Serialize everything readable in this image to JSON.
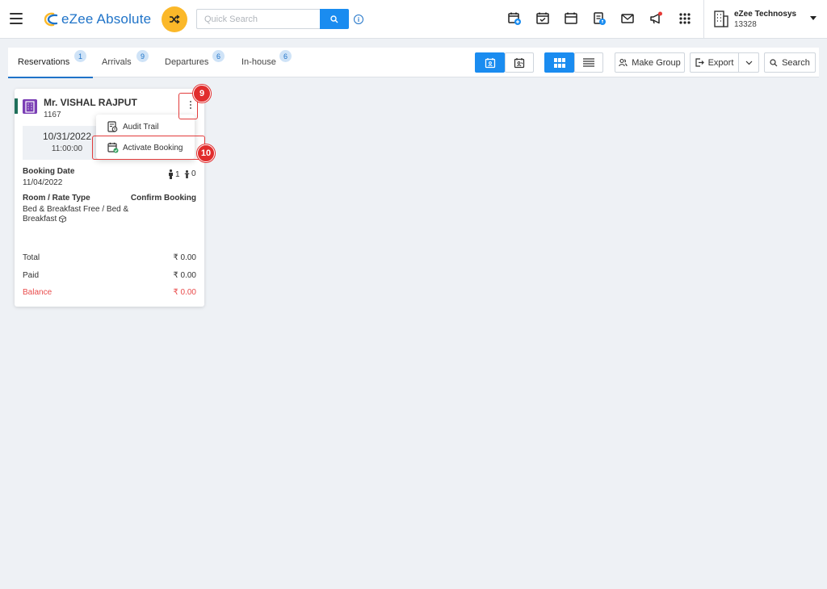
{
  "header": {
    "app_name": "eZee Absolute",
    "search_placeholder": "Quick Search",
    "info_glyph": "i",
    "icons": [
      "hamburger-icon",
      "shuffle-icon",
      "search-icon",
      "info-icon",
      "calendar-add-icon",
      "calendar-check-icon",
      "calendar-icon",
      "document-badge-icon",
      "mail-icon",
      "megaphone-icon",
      "apps-grid-icon",
      "building-icon"
    ],
    "user": {
      "name": "eZee Technosys",
      "id": "13328"
    },
    "colors": {
      "brand_blue": "#1f73c8",
      "shuffle_yellow": "#fbb829",
      "search_blue": "#1a8cf0",
      "notification_red": "#e53935"
    }
  },
  "tabs": [
    {
      "label": "Reservations",
      "count": "1",
      "active": true
    },
    {
      "label": "Arrivals",
      "count": "9",
      "active": false
    },
    {
      "label": "Departures",
      "count": "6",
      "active": false
    },
    {
      "label": "In-house",
      "count": "6",
      "active": false
    }
  ],
  "toolbar": {
    "make_group_label": "Make Group",
    "export_label": "Export",
    "search_label": "Search"
  },
  "card": {
    "guest_name": "Mr. VISHAL RAJPUT",
    "reservation_no": "1167",
    "arrival_date": "10/31/2022",
    "arrival_time": "11:00:00",
    "booking_date_label": "Booking Date",
    "booking_date": "11/04/2022",
    "adults": "1",
    "children": "0",
    "room_rate_label": "Room / Rate Type",
    "status": "Confirm Booking",
    "rate_line1": "Bed & Breakfast Free / Bed &",
    "rate_line2": "Breakfast",
    "total_label": "Total",
    "total_value": "₹ 0.00",
    "paid_label": "Paid",
    "paid_value": "₹ 0.00",
    "balance_label": "Balance",
    "balance_value": "₹ 0.00",
    "strip_color": "#1f6f5a",
    "balance_color": "#e94b4b"
  },
  "context_menu": {
    "items": [
      {
        "label": "Audit Trail",
        "icon": "audit-trail-icon"
      },
      {
        "label": "Activate Booking",
        "icon": "calendar-check-icon"
      }
    ]
  },
  "annotations": {
    "step_9": "9",
    "step_10": "10",
    "highlight_color": "#e23b3b"
  }
}
